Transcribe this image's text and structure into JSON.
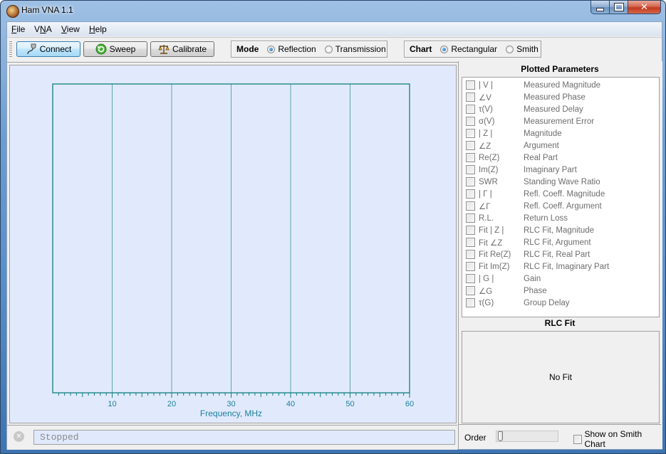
{
  "window": {
    "title": "Ham VNA 1.1",
    "icon": "app-icon",
    "controls": {
      "minimize": "minimize-icon",
      "maximize": "maximize-icon",
      "close": "close-icon"
    }
  },
  "menu": [
    {
      "label": "File",
      "mnemonic": "F"
    },
    {
      "label": "VNA",
      "mnemonic": "N"
    },
    {
      "label": "View",
      "mnemonic": "V"
    },
    {
      "label": "Help",
      "mnemonic": "H"
    }
  ],
  "toolbar": {
    "buttons": [
      {
        "label": "Connect",
        "icon": "connector-plug-icon",
        "active": true
      },
      {
        "label": "Sweep",
        "icon": "refresh-icon",
        "active": false
      },
      {
        "label": "Calibrate",
        "icon": "scales-icon",
        "active": false
      }
    ],
    "mode": {
      "label": "Mode",
      "options": [
        {
          "label": "Reflection",
          "selected": true
        },
        {
          "label": "Transmission",
          "selected": false
        }
      ]
    },
    "chart": {
      "label": "Chart",
      "options": [
        {
          "label": "Rectangular",
          "selected": true
        },
        {
          "label": "Smith",
          "selected": false
        }
      ]
    }
  },
  "chart_data": {
    "type": "line",
    "title": "",
    "xlabel": "Frequency, MHz",
    "ylabel": "",
    "xlim": [
      0,
      60
    ],
    "x_ticks_major": [
      10,
      20,
      30,
      40,
      50,
      60
    ],
    "x_ticks_minor_step": 1,
    "x_ticks_mid_step": 5,
    "grid": true,
    "series": [],
    "colors": {
      "axis": "#0f7f80",
      "grid": "#5aa8a8",
      "background": "#e1eafd",
      "label": "#1a7f9a"
    }
  },
  "plotted_parameters": {
    "title": "Plotted Parameters",
    "items": [
      {
        "symbol": "| V |",
        "name": "Measured Magnitude",
        "checked": false
      },
      {
        "symbol": "∠V",
        "name": "Measured Phase",
        "checked": false
      },
      {
        "symbol": "τ(V)",
        "name": "Measured Delay",
        "checked": false
      },
      {
        "symbol": "σ(V)",
        "name": "Measurement Error",
        "checked": false
      },
      {
        "symbol": "| Z |",
        "name": "Magnitude",
        "checked": false
      },
      {
        "symbol": "∠Z",
        "name": "Argument",
        "checked": false
      },
      {
        "symbol": "Re(Z)",
        "name": "Real Part",
        "checked": false
      },
      {
        "symbol": "Im(Z)",
        "name": "Imaginary Part",
        "checked": false
      },
      {
        "symbol": "SWR",
        "name": "Standing Wave Ratio",
        "checked": false
      },
      {
        "symbol": "| Γ |",
        "name": "Refl. Coeff. Magnitude",
        "checked": false
      },
      {
        "symbol": "∠Γ",
        "name": "Refl. Coeff. Argument",
        "checked": false
      },
      {
        "symbol": "R.L.",
        "name": "Return Loss",
        "checked": false
      },
      {
        "symbol": "Fit | Z |",
        "name": "RLC Fit, Magnitude",
        "checked": false
      },
      {
        "symbol": "Fit ∠Z",
        "name": "RLC Fit, Argument",
        "checked": false
      },
      {
        "symbol": "Fit Re(Z)",
        "name": "RLC Fit, Real Part",
        "checked": false
      },
      {
        "symbol": "Fit Im(Z)",
        "name": "RLC Fit, Imaginary Part",
        "checked": false
      },
      {
        "symbol": "| G |",
        "name": "Gain",
        "checked": false
      },
      {
        "symbol": "∠G",
        "name": "Phase",
        "checked": false
      },
      {
        "symbol": "τ(G)",
        "name": "Group Delay",
        "checked": false
      }
    ]
  },
  "rlc_fit": {
    "title": "RLC Fit",
    "result": "No Fit",
    "order_label": "Order",
    "order_value": 0,
    "show_on_smith_label": "Show on Smith Chart",
    "show_on_smith_checked": false
  },
  "status": {
    "icon": "stopped-icon",
    "text": "Stopped"
  }
}
